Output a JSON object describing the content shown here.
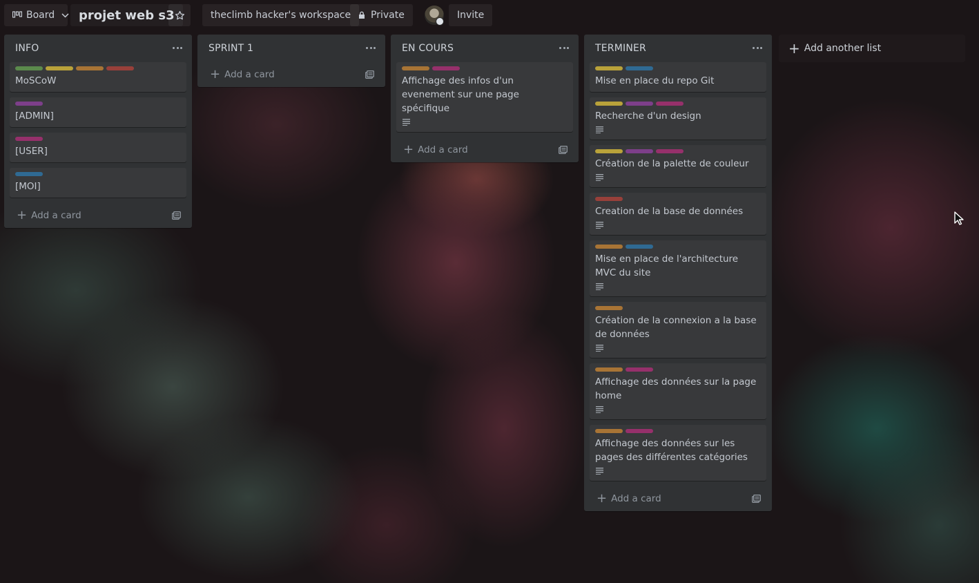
{
  "colors": {
    "green": "#5b8a4c",
    "yellow": "#b9a23a",
    "orange": "#a87435",
    "red": "#98403a",
    "purple": "#7d3f8a",
    "pink": "#96306b",
    "blue": "#2f6a93"
  },
  "header": {
    "board_switch_label": "Board",
    "board_title": "projet web s3",
    "workspace_label": "theclimb hacker's workspace",
    "visibility_label": "Private",
    "invite_label": "Invite"
  },
  "lists": [
    {
      "title": "INFO",
      "add_card_label": "Add a card",
      "cards": [
        {
          "title": "MoSCoW",
          "labels": [
            "green",
            "yellow",
            "orange",
            "red"
          ],
          "has_description": false
        },
        {
          "title": "[ADMIN]",
          "labels": [
            "purple"
          ],
          "has_description": false
        },
        {
          "title": "[USER]",
          "labels": [
            "pink"
          ],
          "has_description": false
        },
        {
          "title": "[MOI]",
          "labels": [
            "blue"
          ],
          "has_description": false
        }
      ]
    },
    {
      "title": "SPRINT 1",
      "add_card_label": "Add a card",
      "cards": []
    },
    {
      "title": "EN COURS",
      "add_card_label": "Add a card",
      "cards": [
        {
          "title": "Affichage des infos d'un evenement sur une page spécifique",
          "labels": [
            "orange",
            "pink"
          ],
          "has_description": true
        }
      ]
    },
    {
      "title": "TERMINER",
      "add_card_label": "Add a card",
      "cards": [
        {
          "title": "Mise en place du repo Git",
          "labels": [
            "yellow",
            "blue"
          ],
          "has_description": false
        },
        {
          "title": "Recherche d'un design",
          "labels": [
            "yellow",
            "purple",
            "pink"
          ],
          "has_description": true
        },
        {
          "title": "Création de la palette de couleur",
          "labels": [
            "yellow",
            "purple",
            "pink"
          ],
          "has_description": true
        },
        {
          "title": "Creation de la base de données",
          "labels": [
            "red"
          ],
          "has_description": true
        },
        {
          "title": "Mise en place de l'architecture MVC du site",
          "labels": [
            "orange",
            "blue"
          ],
          "has_description": true
        },
        {
          "title": "Création de la connexion a la base de données",
          "labels": [
            "orange"
          ],
          "has_description": true
        },
        {
          "title": "Affichage des données sur la page home",
          "labels": [
            "orange",
            "pink"
          ],
          "has_description": true
        },
        {
          "title": "Affichage des données sur les pages des différentes catégories",
          "labels": [
            "orange",
            "pink"
          ],
          "has_description": true
        }
      ]
    }
  ],
  "add_list_label": "Add another list"
}
